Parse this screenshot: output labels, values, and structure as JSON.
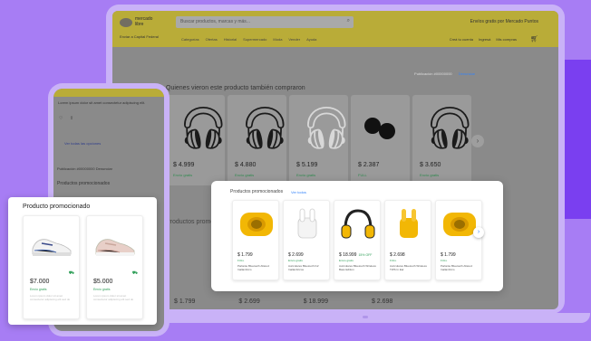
{
  "laptop": {
    "logo_text": "mercado libre",
    "search_placeholder": "Buscar productos, marcas y más...",
    "promo_banner": "Envíos gratis por Mercado Puntos",
    "location": "Enviar a Capital Federal",
    "nav": [
      "Categorías",
      "Ofertas",
      "Historial",
      "Supermercado",
      "Moda",
      "Vender",
      "Ayuda"
    ],
    "account": [
      "Creá tu cuenta",
      "Ingresá",
      "Mis compras"
    ],
    "publication": "Publicación #00000000",
    "publication_link": "Denunciar",
    "section_title": "Quienes vieron este producto también compraron",
    "products": [
      {
        "price": "$ 4.999",
        "ship": "Envío gratis"
      },
      {
        "price": "$ 4.880",
        "ship": "Envío gratis"
      },
      {
        "price": "$ 5.199",
        "ship": "Envío gratis"
      },
      {
        "price": "$ 2.387",
        "ship": "FULL"
      },
      {
        "price": "$ 3.650",
        "ship": "Envío gratis"
      }
    ],
    "section2_title": "Productos promocionados",
    "bottom_prices": [
      "$ 1.799",
      "$ 2.699",
      "$ 18.999",
      "$ 2.698"
    ]
  },
  "phone": {
    "text": "Lorem ipsum dolor sit amet consectetur adipiscing elit.",
    "link": "Ver todas las opciones",
    "publication": "Publicación #00000000 Denunciar",
    "promo_title": "Productos promocionados"
  },
  "promo_card": {
    "title": "Producto promocionado",
    "items": [
      {
        "price": "$7.000",
        "ship": "Envío gratis",
        "desc": "Lorem ipsum dolor sit amet consectetur adipiscing elit sed do"
      },
      {
        "price": "$5.000",
        "ship": "Envío gratis",
        "desc": "Lorem ipsum dolor sit amet consectetur adipiscing elit sed do"
      }
    ]
  },
  "promos_card": {
    "title": "Productos promocionados",
    "link": "Ver todos",
    "items": [
      {
        "price": "$ 1.799",
        "off": "",
        "ship": "FULL",
        "name": "Parlante Bluetooth Altavoz Inalámbrico"
      },
      {
        "price": "$ 2.699",
        "off": "",
        "ship": "Envío gratis",
        "name": "Auriculares Bluetooth I12 Inalámbricos"
      },
      {
        "price": "$ 18.999",
        "off": "15% OFF",
        "ship": "Envío gratis",
        "name": "Auriculares Bluetooth Wireless Bass Edition"
      },
      {
        "price": "$ 2.698",
        "off": "",
        "ship": "FULL",
        "name": "Auriculares Bluetooth Wireless TWS In Ear"
      },
      {
        "price": "$ 1.799",
        "off": "",
        "ship": "FULL",
        "name": "Parlante Bluetooth Altavoz Inalámbrico"
      }
    ]
  },
  "colors": {
    "background": "#a77df4",
    "accent": "#7a3ff0",
    "ml_yellow": "#fff159",
    "speaker_yellow": "#f2b705"
  }
}
